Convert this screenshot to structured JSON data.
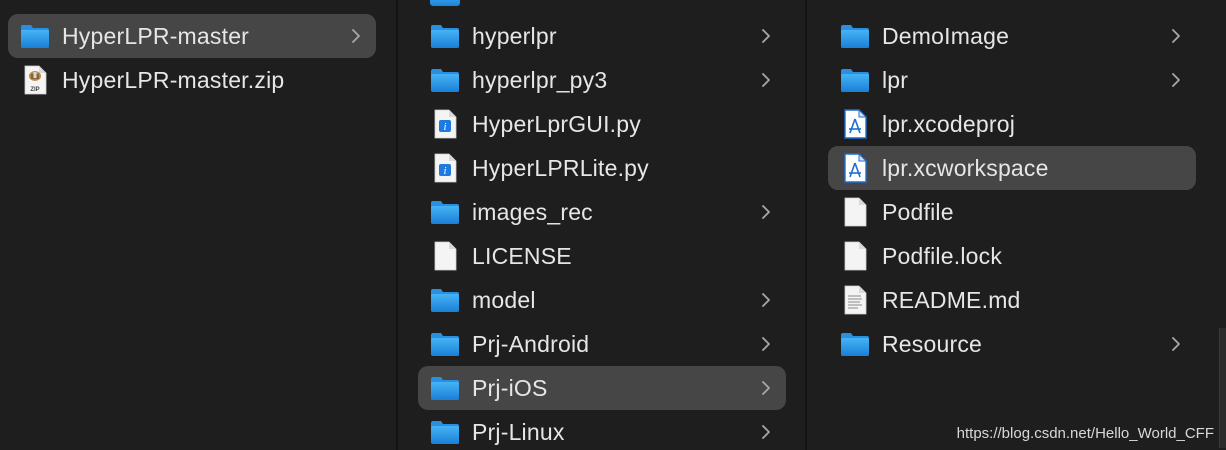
{
  "columns": [
    {
      "items": [
        {
          "label": "HyperLPR-master",
          "icon": "folder-icon",
          "has_children": true,
          "selected": true
        },
        {
          "label": "HyperLPR-master.zip",
          "icon": "zip-archive-icon",
          "has_children": false,
          "selected": false
        }
      ]
    },
    {
      "items": [
        {
          "label": "hyperlpr",
          "icon": "folder-icon",
          "has_children": true,
          "selected": false
        },
        {
          "label": "hyperlpr_py3",
          "icon": "folder-icon",
          "has_children": true,
          "selected": false
        },
        {
          "label": "HyperLprGUI.py",
          "icon": "python-file-icon",
          "has_children": false,
          "selected": false
        },
        {
          "label": "HyperLPRLite.py",
          "icon": "python-file-icon",
          "has_children": false,
          "selected": false
        },
        {
          "label": "images_rec",
          "icon": "folder-icon",
          "has_children": true,
          "selected": false
        },
        {
          "label": "LICENSE",
          "icon": "document-icon",
          "has_children": false,
          "selected": false
        },
        {
          "label": "model",
          "icon": "folder-icon",
          "has_children": true,
          "selected": false
        },
        {
          "label": "Prj-Android",
          "icon": "folder-icon",
          "has_children": true,
          "selected": false
        },
        {
          "label": "Prj-iOS",
          "icon": "folder-icon",
          "has_children": true,
          "selected": true
        },
        {
          "label": "Prj-Linux",
          "icon": "folder-icon",
          "has_children": true,
          "selected": false
        }
      ]
    },
    {
      "items": [
        {
          "label": "DemoImage",
          "icon": "folder-icon",
          "has_children": true,
          "selected": false
        },
        {
          "label": "lpr",
          "icon": "folder-icon",
          "has_children": true,
          "selected": false
        },
        {
          "label": "lpr.xcodeproj",
          "icon": "xcode-project-icon",
          "has_children": false,
          "selected": false
        },
        {
          "label": "lpr.xcworkspace",
          "icon": "xcode-project-icon",
          "has_children": false,
          "selected": true
        },
        {
          "label": "Podfile",
          "icon": "document-icon",
          "has_children": false,
          "selected": false
        },
        {
          "label": "Podfile.lock",
          "icon": "document-icon",
          "has_children": false,
          "selected": false
        },
        {
          "label": "README.md",
          "icon": "text-document-icon",
          "has_children": false,
          "selected": false
        },
        {
          "label": "Resource",
          "icon": "folder-icon",
          "has_children": true,
          "selected": false
        }
      ]
    }
  ],
  "watermark": "https://blog.csdn.net/Hello_World_CFF",
  "colors": {
    "background": "#1e1e1e",
    "selection": "#464646",
    "folder_top": "#3aa7ee",
    "folder_bottom": "#1b82d8"
  }
}
